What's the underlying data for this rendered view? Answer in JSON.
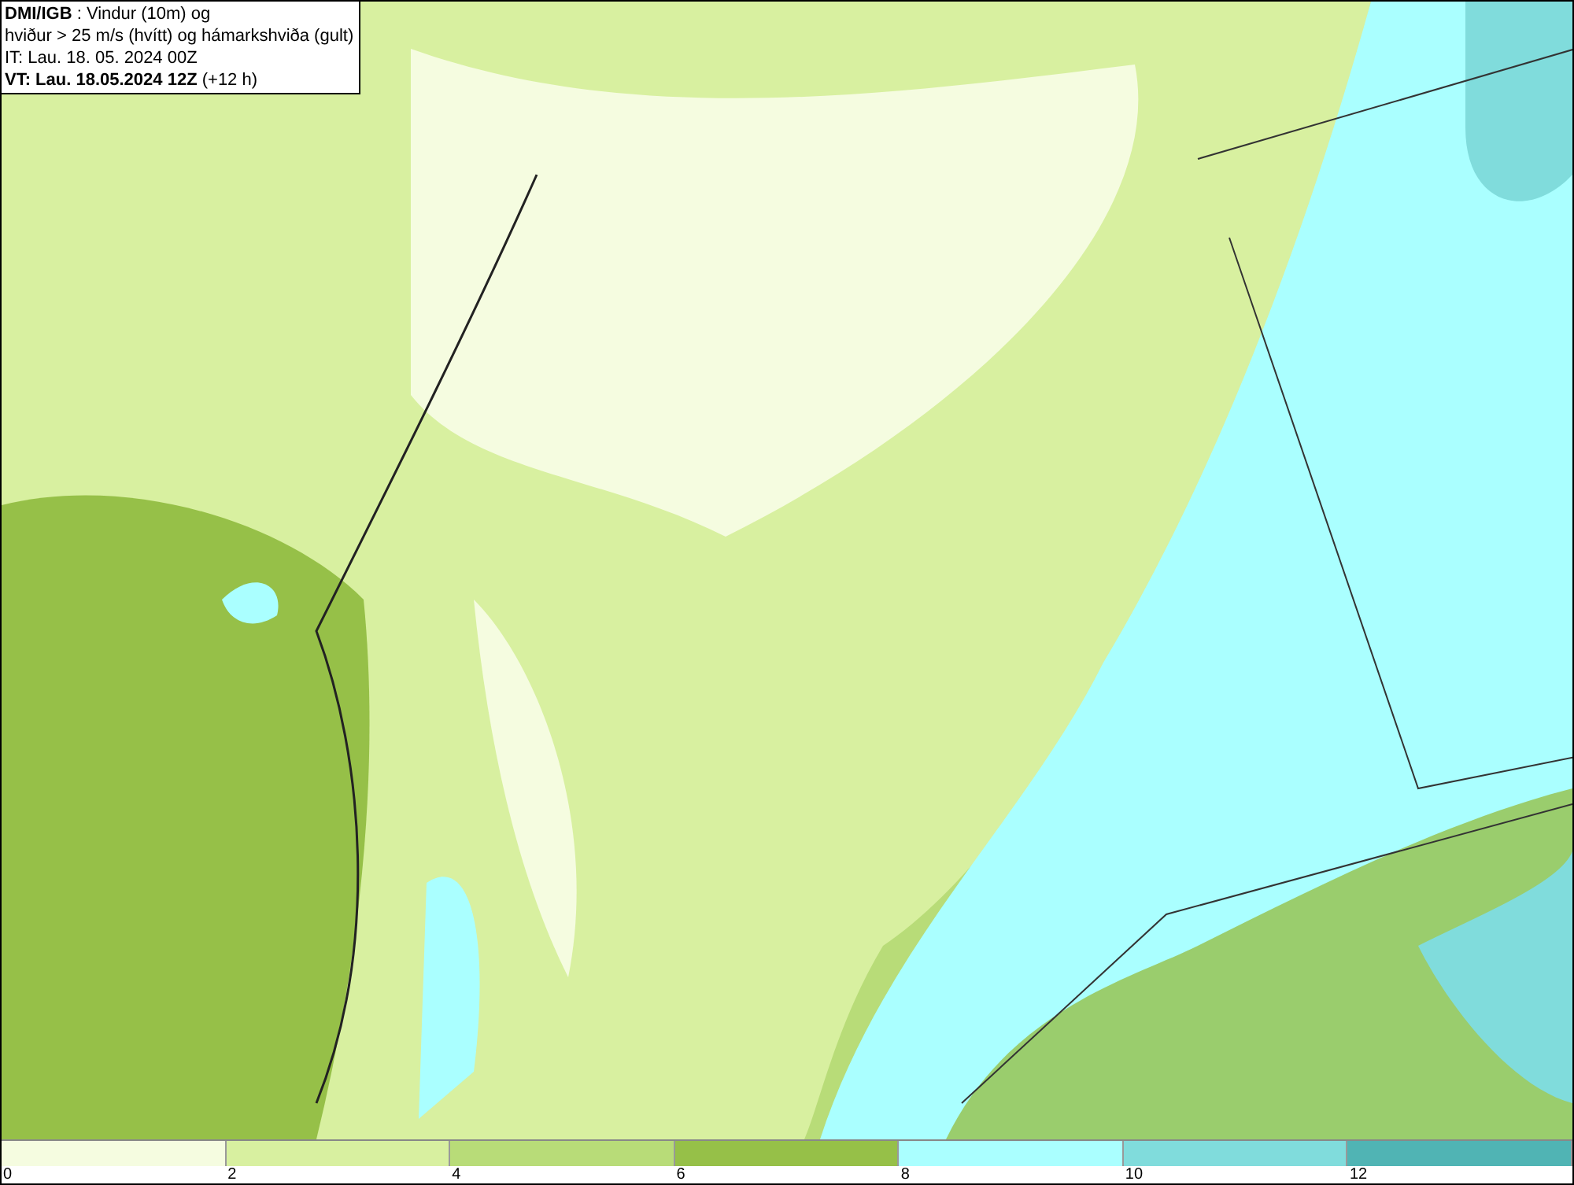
{
  "info_box": {
    "lines": [
      "**DMI/IGB** : Vindur (10m) og",
      "hviður > 25 m/s (hvítt) og hámarkshviða (gult)",
      "IT: Lau. 18. 05. 2024 00Z",
      "**VT: Lau. 18.05.2024 12Z** (+12 h)"
    ]
  },
  "legend": [
    {
      "label": "0",
      "color": "#f5fce0"
    },
    {
      "label": "2",
      "color": "#d8f0a0"
    },
    {
      "label": "4",
      "color": "#b8dc78"
    },
    {
      "label": "6",
      "color": "#96c048"
    },
    {
      "label": "8",
      "color": "#aaffff"
    },
    {
      "label": "10",
      "color": "#80dcdc"
    },
    {
      "label": "12",
      "color": "#50b4b4"
    }
  ]
}
